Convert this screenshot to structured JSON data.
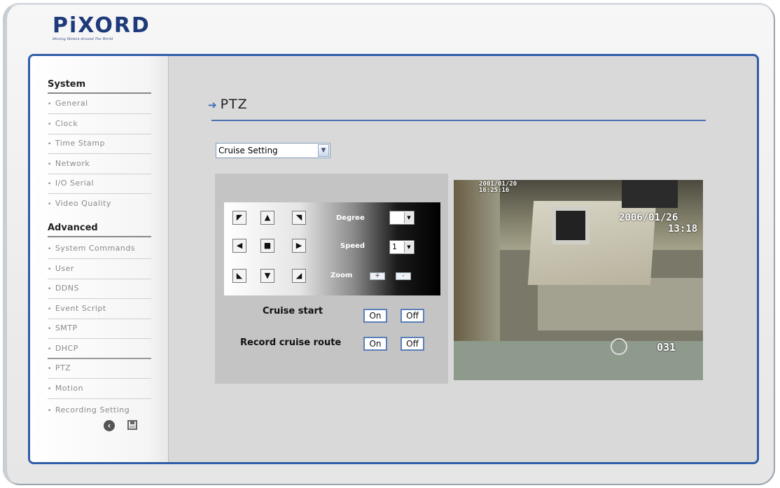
{
  "brand": {
    "name": "PiXORD",
    "tagline": "Moving Motion Around The World"
  },
  "sidebar": {
    "sections": [
      {
        "title": "System",
        "items": [
          "General",
          "Clock",
          "Time Stamp",
          "Network",
          "I/O Serial",
          "Video Quality"
        ]
      },
      {
        "title": "Advanced",
        "items": [
          "System Commands",
          "User",
          "DDNS",
          "Event Script",
          "SMTP",
          "DHCP",
          "PTZ",
          "Motion",
          "Recording Setting"
        ]
      }
    ],
    "icons": [
      "back-icon",
      "save-icon"
    ]
  },
  "page": {
    "title": "PTZ",
    "mode_select": {
      "value": "Cruise Setting"
    }
  },
  "ptz": {
    "degree_label": "Degree",
    "degree_value": "",
    "speed_label": "Speed",
    "speed_value": "1",
    "zoom_label": "Zoom",
    "zoom_in": "+",
    "zoom_out": "-",
    "cruise_start_label": "Cruise start",
    "record_cruise_label": "Record cruise route",
    "on_label": "On",
    "off_label": "Off"
  },
  "video": {
    "stamp_top_left": "2001/01/20\n16:25:16",
    "stamp_date": "2006/01/26",
    "stamp_time": "13:18",
    "stamp_num": "031"
  },
  "colors": {
    "accent": "#2f5da8",
    "brand": "#1e3a7a",
    "panel": "#d9d9d9"
  }
}
